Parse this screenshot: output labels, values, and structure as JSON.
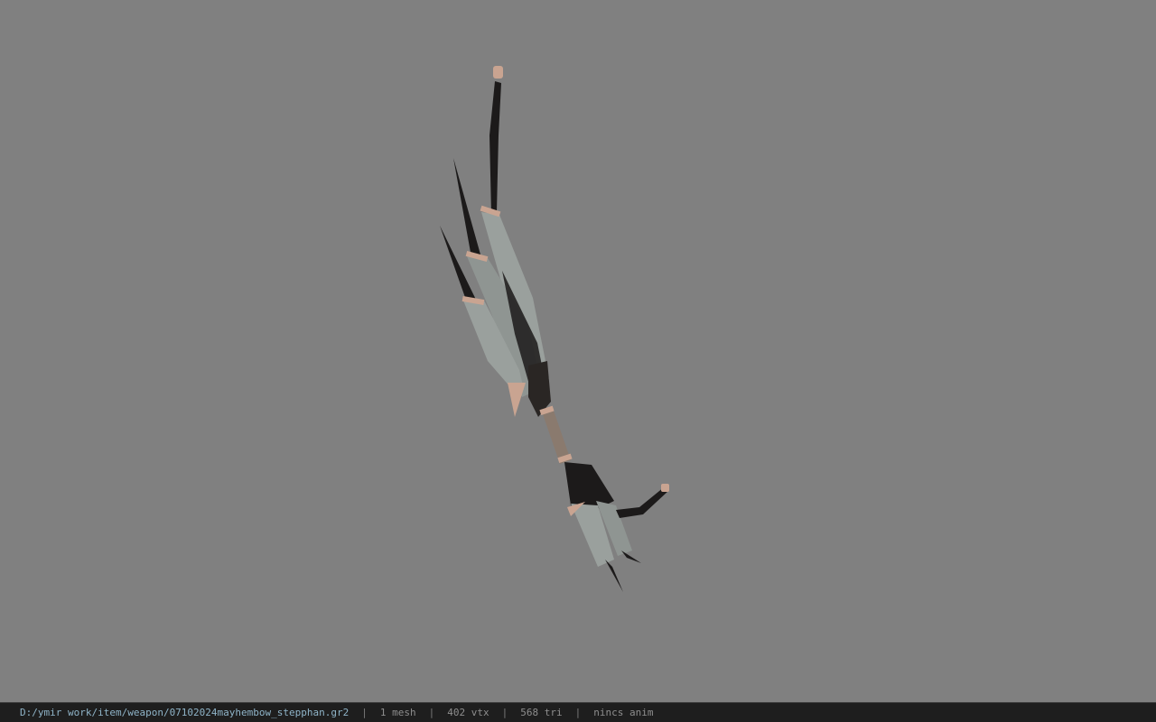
{
  "viewport": {
    "background_color": "#808080",
    "model": {
      "icon": "bow-model",
      "colors": {
        "blade": "#9aa09d",
        "blade_shadow": "#6f7472",
        "dark": "#1c1a1a",
        "trim": "#c9a491"
      }
    }
  },
  "status": {
    "file_path": "D:/ymir work/item/weapon/07102024mayhembow_stepphan.gr2",
    "mesh_count": "1 mesh",
    "vertex_count": "402 vtx",
    "triangle_count": "568 tri",
    "animation": "nincs anim",
    "separator": "|"
  }
}
